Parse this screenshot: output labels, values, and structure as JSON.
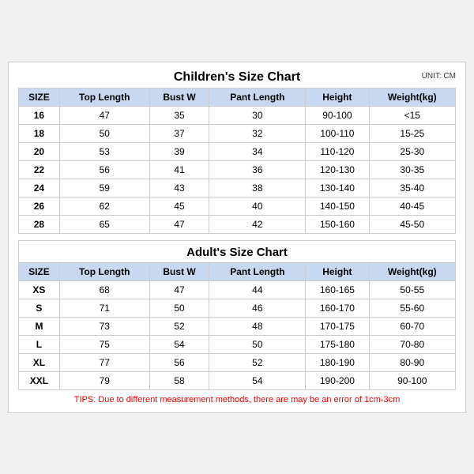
{
  "chartTitle": "Children's Size Chart",
  "unitLabel": "UNIT: CM",
  "children": {
    "headers": [
      "SIZE",
      "Top Length",
      "Bust W",
      "Pant Length",
      "Height",
      "Weight(kg)"
    ],
    "rows": [
      [
        "16",
        "47",
        "35",
        "30",
        "90-100",
        "<15"
      ],
      [
        "18",
        "50",
        "37",
        "32",
        "100-110",
        "15-25"
      ],
      [
        "20",
        "53",
        "39",
        "34",
        "110-120",
        "25-30"
      ],
      [
        "22",
        "56",
        "41",
        "36",
        "120-130",
        "30-35"
      ],
      [
        "24",
        "59",
        "43",
        "38",
        "130-140",
        "35-40"
      ],
      [
        "26",
        "62",
        "45",
        "40",
        "140-150",
        "40-45"
      ],
      [
        "28",
        "65",
        "47",
        "42",
        "150-160",
        "45-50"
      ]
    ]
  },
  "adultTitle": "Adult's Size Chart",
  "adults": {
    "headers": [
      "SIZE",
      "Top Length",
      "Bust W",
      "Pant Length",
      "Height",
      "Weight(kg)"
    ],
    "rows": [
      [
        "XS",
        "68",
        "47",
        "44",
        "160-165",
        "50-55"
      ],
      [
        "S",
        "71",
        "50",
        "46",
        "160-170",
        "55-60"
      ],
      [
        "M",
        "73",
        "52",
        "48",
        "170-175",
        "60-70"
      ],
      [
        "L",
        "75",
        "54",
        "50",
        "175-180",
        "70-80"
      ],
      [
        "XL",
        "77",
        "56",
        "52",
        "180-190",
        "80-90"
      ],
      [
        "XXL",
        "79",
        "58",
        "54",
        "190-200",
        "90-100"
      ]
    ]
  },
  "tips": "TIPS: Due to different measurement methods, there are may be an error of 1cm-3cm"
}
